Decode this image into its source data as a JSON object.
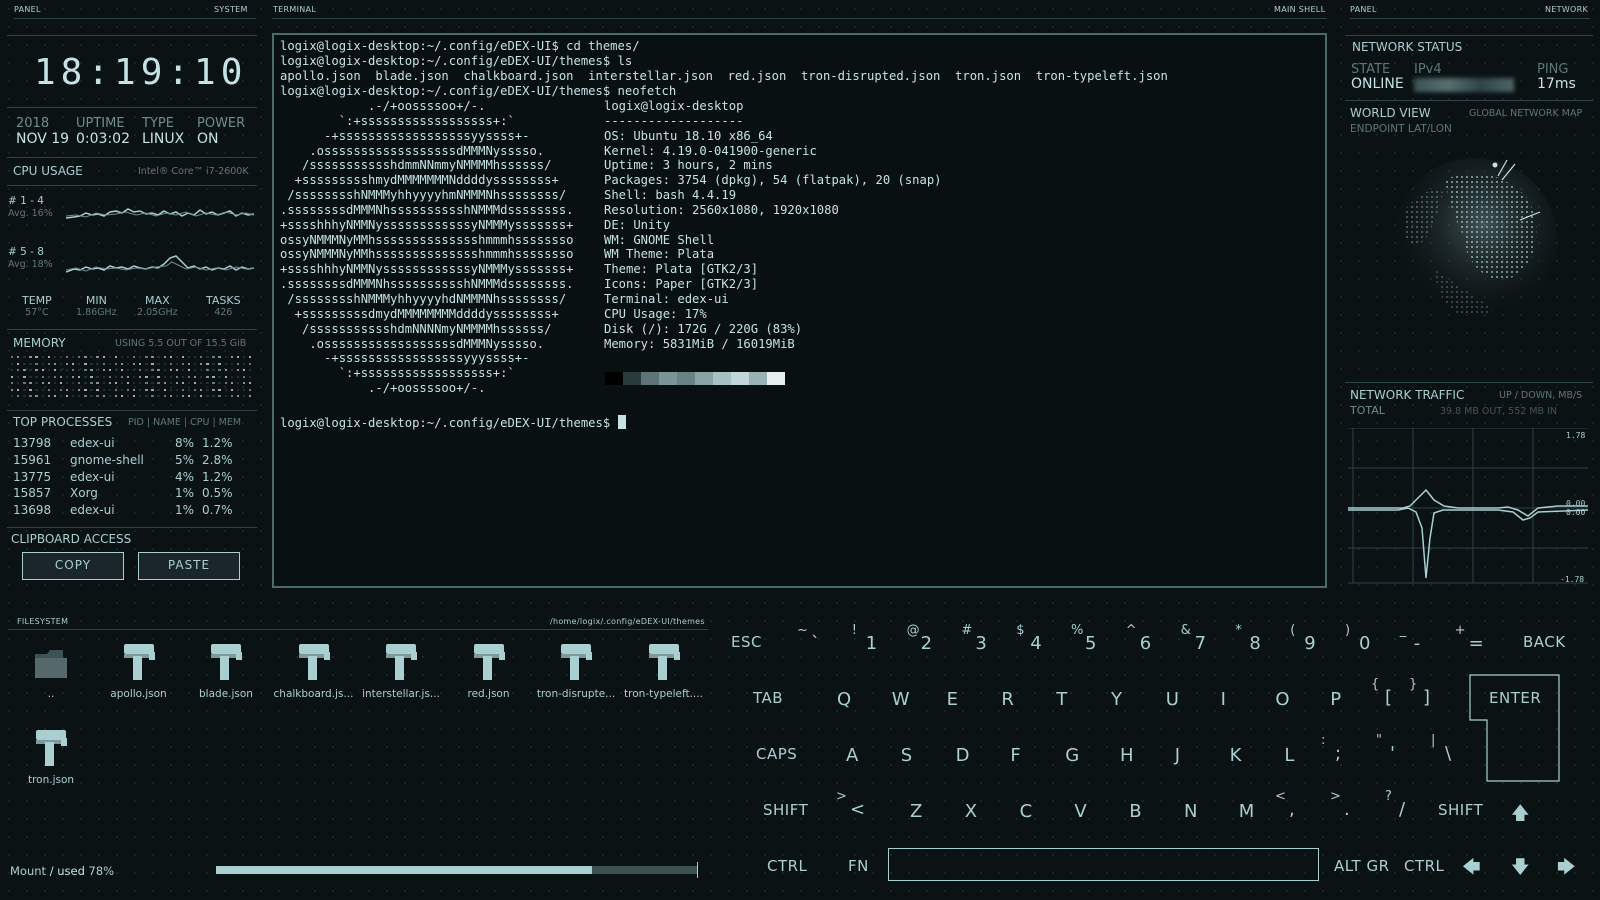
{
  "headers": {
    "panel_left": "PANEL",
    "system": "SYSTEM",
    "terminal": "TERMINAL",
    "main_shell": "MAIN SHELL",
    "panel_right": "PANEL",
    "network": "NETWORK",
    "filesystem": "FILESYSTEM",
    "fs_path": "/home/logix/.config/eDEX-UI/themes"
  },
  "system": {
    "clock": "18:19:10",
    "year_label": "2018",
    "date": "NOV 19",
    "uptime_label": "UPTIME",
    "uptime": "0:03:02",
    "type_label": "TYPE",
    "type": "LINUX",
    "power_label": "POWER",
    "power": "ON"
  },
  "cpu": {
    "title": "CPU USAGE",
    "model": "Intel® Core™ i7-2600K",
    "core1_label": "# 1 - 4",
    "core1_avg": "Avg. 16%",
    "core2_label": "# 5 - 8",
    "core2_avg": "Avg. 18%",
    "temp_label": "TEMP",
    "temp": "57°C",
    "min_label": "MIN",
    "min": "1.86GHz",
    "max_label": "MAX",
    "max": "2.05GHz",
    "tasks_label": "TASKS",
    "tasks": "426"
  },
  "memory": {
    "title": "MEMORY",
    "usage": "USING 5.5 OUT OF 15.5 GiB"
  },
  "processes": {
    "title": "TOP PROCESSES",
    "columns": "PID | NAME | CPU | MEM",
    "rows": [
      {
        "pid": "13798",
        "name": "edex-ui",
        "cpu": "8%",
        "mem": "1.2%"
      },
      {
        "pid": "15961",
        "name": "gnome-shell",
        "cpu": "5%",
        "mem": "2.8%"
      },
      {
        "pid": "13775",
        "name": "edex-ui",
        "cpu": "4%",
        "mem": "1.2%"
      },
      {
        "pid": "15857",
        "name": "Xorg",
        "cpu": "1%",
        "mem": "0.5%"
      },
      {
        "pid": "13698",
        "name": "edex-ui",
        "cpu": "1%",
        "mem": "0.7%"
      }
    ]
  },
  "clipboard": {
    "title": "CLIPBOARD ACCESS",
    "copy": "COPY",
    "paste": "PASTE"
  },
  "terminal": {
    "lines": "logix@logix-desktop:~/.config/eDEX-UI$ cd themes/\nlogix@logix-desktop:~/.config/eDEX-UI/themes$ ls\napollo.json  blade.json  chalkboard.json  interstellar.json  red.json  tron-disrupted.json  tron.json  tron-typeleft.json\nlogix@logix-desktop:~/.config/eDEX-UI/themes$ neofetch",
    "logo": "            .-/+oossssoo+/-.\n        `:+ssssssssssssssssss+:`\n      -+ssssssssssssssssssyyssss+-\n    .ossssssssssssssssssdMMMNysssso.\n   /ssssssssssshdmmNNmmyNMMMMhssssss/\n  +ssssssssshmydMMMMMMMNddddyssssssss+\n /sssssssshNMMMyhhyyyyhmNMMMNhssssssss/\n.ssssssssdMMMNhsssssssssshNMMMdssssssss.\n+sssshhhyNMMNyssssssssssssyNMMMysssssss+\nossyNMMMNyMMhsssssssssssssshmmmhssssssso\nossyNMMMNyMMhsssssssssssssshmmmhssssssso\n+sssshhhyNMMNyssssssssssssyNMMMysssssss+\n.ssssssssdMMMNhsssssssssshNMMMdssssssss.\n /sssssssshNMMMyhhyyyyhdNMMMNhssssssss/\n  +sssssssssdmydMMMMMMMMddddyssssssss+\n   /ssssssssssshdmNNNNmyNMMMMhssssss/\n    .ossssssssssssssssssdMMMNysssso.\n      -+sssssssssssssssssyyyssss+-\n        `:+ssssssssssssssssss+:`\n            .-/+oossssoo+/-.",
    "info": "logix@logix-desktop\n-------------------\nOS: Ubuntu 18.10 x86_64\nKernel: 4.19.0-041900-generic\nUptime: 3 hours, 2 mins\nPackages: 3754 (dpkg), 54 (flatpak), 20 (snap)\nShell: bash 4.4.19\nResolution: 2560x1080, 1920x1080\nDE: Unity\nWM: GNOME Shell\nWM Theme: Plata\nTheme: Plata [GTK2/3]\nIcons: Paper [GTK2/3]\nTerminal: edex-ui\nCPU Usage: 17%\nDisk (/): 172G / 220G (83%)\nMemory: 5831MiB / 16019MiB",
    "prompt": "logix@logix-desktop:~/.config/eDEX-UI/themes$ ",
    "palette": [
      "#000000",
      "#2b3a3c",
      "#5d7577",
      "#7c9496",
      "#6a8284",
      "#8aa2a4",
      "#a8c0c2",
      "#c0d6d8",
      "#9ab2b4",
      "#e6f0f1"
    ]
  },
  "network": {
    "status_title": "NETWORK STATUS",
    "state_label": "STATE",
    "state": "ONLINE",
    "ipv4_label": "IPv4",
    "ping_label": "PING",
    "ping": "17ms",
    "world_title": "WORLD VIEW",
    "world_sub": "GLOBAL NETWORK MAP",
    "endpoint": "ENDPOINT LAT/LON",
    "traffic_title": "NETWORK TRAFFIC",
    "traffic_sub": "UP / DOWN, MB/S",
    "total_label": "TOTAL",
    "total": "39.8 MB OUT, 552 MB IN",
    "y_top": "1.78",
    "y_mid1": "0.00",
    "y_mid2": "0.00",
    "y_bottom": "-1.78"
  },
  "filesystem": {
    "files": [
      {
        "name": "..",
        "type": "folder"
      },
      {
        "name": "apollo.json",
        "type": "file"
      },
      {
        "name": "blade.json",
        "type": "file"
      },
      {
        "name": "chalkboard.js...",
        "type": "file"
      },
      {
        "name": "interstellar.js...",
        "type": "file"
      },
      {
        "name": "red.json",
        "type": "file"
      },
      {
        "name": "tron-disrupte...",
        "type": "file"
      },
      {
        "name": "tron-typeleft....",
        "type": "file"
      },
      {
        "name": "tron.json",
        "type": "file"
      }
    ],
    "mount_label": "Mount",
    "mount_used": "/ used",
    "mount_pct": "78%",
    "mount_fraction": 0.78
  },
  "keyboard": {
    "row1": [
      {
        "main": "`",
        "shift": "~"
      },
      {
        "main": "1",
        "shift": "!"
      },
      {
        "main": "2",
        "shift": "@"
      },
      {
        "main": "3",
        "shift": "#"
      },
      {
        "main": "4",
        "shift": "$"
      },
      {
        "main": "5",
        "shift": "%"
      },
      {
        "main": "6",
        "shift": "^"
      },
      {
        "main": "7",
        "shift": "&"
      },
      {
        "main": "8",
        "shift": "*"
      },
      {
        "main": "9",
        "shift": "("
      },
      {
        "main": "0",
        "shift": ")"
      },
      {
        "main": "-",
        "shift": "_"
      },
      {
        "main": "=",
        "shift": "+"
      }
    ],
    "row2": [
      "Q",
      "W",
      "E",
      "R",
      "T",
      "Y",
      "U",
      "I",
      "O",
      "P"
    ],
    "row2_extra": [
      {
        "main": "[",
        "shift": "{"
      },
      {
        "main": "]",
        "shift": "}"
      }
    ],
    "row3": [
      "A",
      "S",
      "D",
      "F",
      "G",
      "H",
      "J",
      "K",
      "L"
    ],
    "row3_extra": [
      {
        "main": ";",
        "shift": ":"
      },
      {
        "main": "'",
        "shift": "\""
      },
      {
        "main": "\\",
        "shift": "|"
      }
    ],
    "row4": [
      "Z",
      "X",
      "C",
      "V",
      "B",
      "N",
      "M"
    ],
    "row4_extra": [
      {
        "main": "<",
        "shift": ">"
      },
      {
        "main": ",",
        "shift": "<"
      },
      {
        "main": ".",
        "shift": ">"
      },
      {
        "main": "/",
        "shift": "?"
      }
    ],
    "esc": "ESC",
    "back": "BACK",
    "tab": "TAB",
    "enter": "ENTER",
    "caps": "CAPS",
    "shift_l": "SHIFT",
    "shift_r": "SHIFT",
    "ctrl_l": "CTRL",
    "fn": "FN",
    "altgr": "ALT GR",
    "ctrl_r": "CTRL",
    "arrow_up": "🡅",
    "arrow_left": "🡄",
    "arrow_down": "🡇",
    "arrow_right": "🡆"
  },
  "colors": {
    "accent": "#aacfd1",
    "bg": "#0b1214",
    "dim": "#5d7779"
  }
}
